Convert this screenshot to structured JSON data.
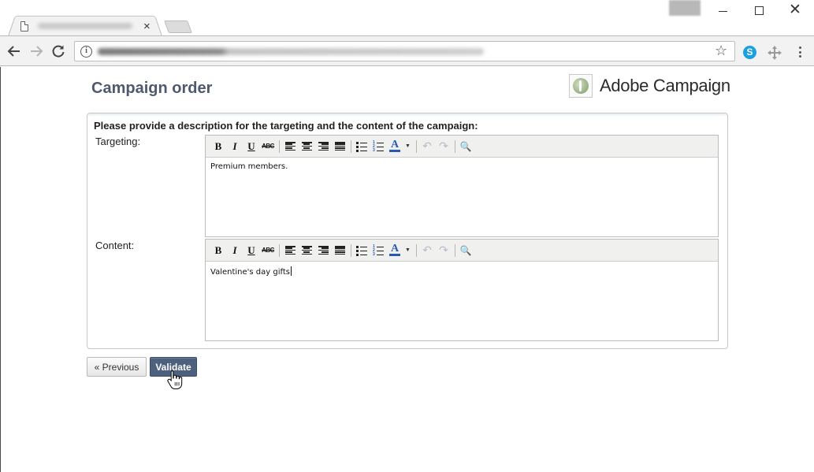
{
  "browser": {
    "tab_close_glyph": "×",
    "window_close_glyph": "✕",
    "star_glyph": "☆",
    "info_glyph": "i",
    "skype_glyph": "S"
  },
  "page": {
    "title": "Campaign order",
    "brand_name": "Adobe Campaign"
  },
  "form": {
    "heading": "Please provide a description for the targeting and the content of the campaign:",
    "targeting": {
      "label": "Targeting:",
      "value": "Premium members."
    },
    "content": {
      "label": "Content:",
      "value": "Valentine's day gifts"
    }
  },
  "editor_toolbar": {
    "bold": "B",
    "italic": "I",
    "underline": "U",
    "strikethrough": "ABC",
    "font_color": "A",
    "dropdown": "▼",
    "undo": "↶",
    "redo": "↷",
    "find": "🔍"
  },
  "buttons": {
    "previous": "« Previous",
    "validate": "Validate"
  },
  "colors": {
    "title": "#4e5a6c",
    "validate_bg": "#4d607d",
    "toolbar_bg": "#f0f0ee",
    "skype": "#1aa0e2"
  }
}
